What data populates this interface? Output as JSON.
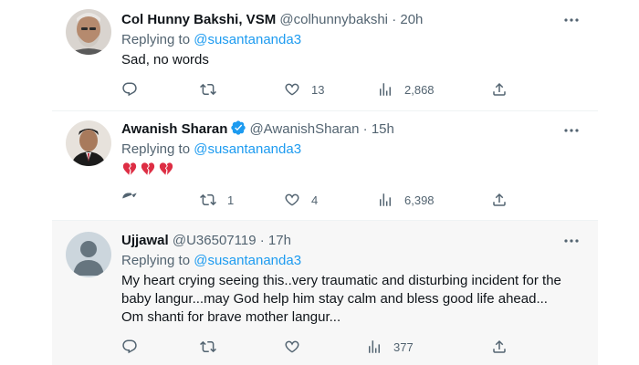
{
  "tweets": [
    {
      "name": "Col Hunny Bakshi, VSM",
      "handle": "@colhunnybakshi",
      "dot": "·",
      "time": "20h",
      "replying_label": "Replying to",
      "replying_to": "@susantananda3",
      "text": "Sad, no words",
      "verified": false,
      "avatar_icon": "avatar-photo",
      "counts": {
        "replies": "",
        "retweets": "",
        "likes": "13",
        "views": "2,868"
      }
    },
    {
      "name": "Awanish Sharan",
      "handle": "@AwanishSharan",
      "dot": "·",
      "time": "15h",
      "replying_label": "Replying to",
      "replying_to": "@susantananda3",
      "text": "",
      "emoji": [
        "broken-heart-icon",
        "broken-heart-icon",
        "broken-heart-icon"
      ],
      "verified": true,
      "avatar_icon": "avatar-photo",
      "counts": {
        "replies": "",
        "retweets": "1",
        "likes": "4",
        "views": "6,398"
      }
    },
    {
      "name": "Ujjawal",
      "handle": "@U36507119",
      "dot": "·",
      "time": "17h",
      "replying_label": "Replying to",
      "replying_to": "@susantananda3",
      "text": "My heart crying seeing this..very traumatic and disturbing incident for the baby langur...may God help him stay calm and bless good life ahead... Om shanti for brave mother langur...",
      "verified": false,
      "avatar_icon": "default-avatar-icon",
      "counts": {
        "replies": "",
        "retweets": "",
        "likes": "",
        "views": "377"
      }
    }
  ],
  "colors": {
    "link": "#1d9bf0",
    "secondary_text": "#536471",
    "hover_bg": "#f7f7f7",
    "broken_heart": "#e0245e",
    "verified": "#1d9bf0"
  }
}
